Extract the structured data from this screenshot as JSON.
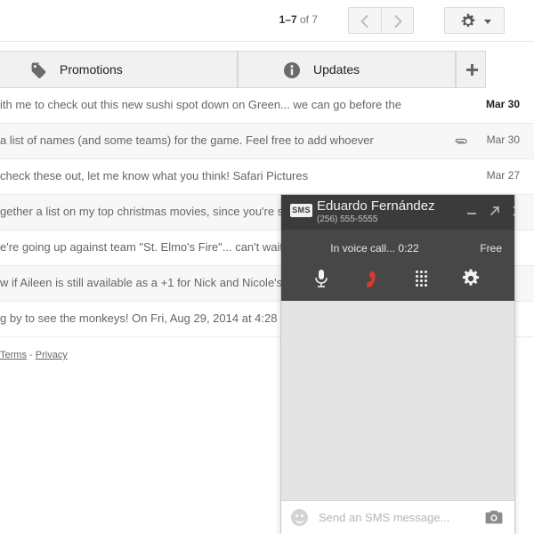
{
  "toolbar": {
    "pager_range": "1–7",
    "pager_of": " of 7",
    "prev_label": "Newer",
    "next_label": "Older",
    "settings_label": "Settings"
  },
  "tabs": [
    {
      "label": "Promotions",
      "icon": "tag-icon"
    },
    {
      "label": "Updates",
      "icon": "info-icon"
    },
    {
      "label": "+",
      "icon": "plus-icon"
    }
  ],
  "mail_rows": [
    {
      "snippet": "ith me to check out this new sushi spot down on Green... we can go before the",
      "date": "Mar 30",
      "unread": true,
      "attachment": false
    },
    {
      "snippet": "a list of names (and some teams) for the game. Feel free to add whoever",
      "date": "Mar 30",
      "unread": false,
      "attachment": true
    },
    {
      "snippet": "check these out, let me know what you think!  Safari Pictures",
      "date": "Mar 27",
      "unread": false,
      "attachment": false
    },
    {
      "snippet": "gether a list on my top christmas movies, since you're s",
      "date": "",
      "unread": false,
      "attachment": false
    },
    {
      "snippet": "e're going up against team \"St. Elmo's Fire\"... can't wait",
      "date": "",
      "unread": false,
      "attachment": false
    },
    {
      "snippet": "w if Aileen is still available as a +1 for Nick and Nicole's",
      "date": "",
      "unread": false,
      "attachment": false
    },
    {
      "snippet": "g by to see the monkeys! On Fri, Aug 29, 2014 at 4:28",
      "date": "",
      "unread": false,
      "attachment": false
    }
  ],
  "footer": {
    "terms": "Terms",
    "separator": "-",
    "privacy": "Privacy"
  },
  "sms_window": {
    "badge": "SMS",
    "contact_name": "Eduardo Fernández",
    "contact_number": "(256) 555-5555",
    "minimize_label": "Minimize",
    "popout_label": "Pop-out",
    "close_label": "Close",
    "call_status": "In voice call... 0:22",
    "call_cost": "Free",
    "buttons": {
      "mic": "Mute microphone",
      "hangup": "End call",
      "dialpad": "Dialpad",
      "settings": "Call settings"
    },
    "composer": {
      "placeholder": "Send an SMS message...",
      "value": "",
      "emoji_label": "Insert emoji",
      "camera_label": "Send photo"
    }
  },
  "colors": {
    "titlebar": "#3b3b3b",
    "callbar": "#474747",
    "chat_body": "#e4e4e4",
    "hangup_red": "#db3a2c",
    "tab_bg": "#f1f1f1"
  }
}
